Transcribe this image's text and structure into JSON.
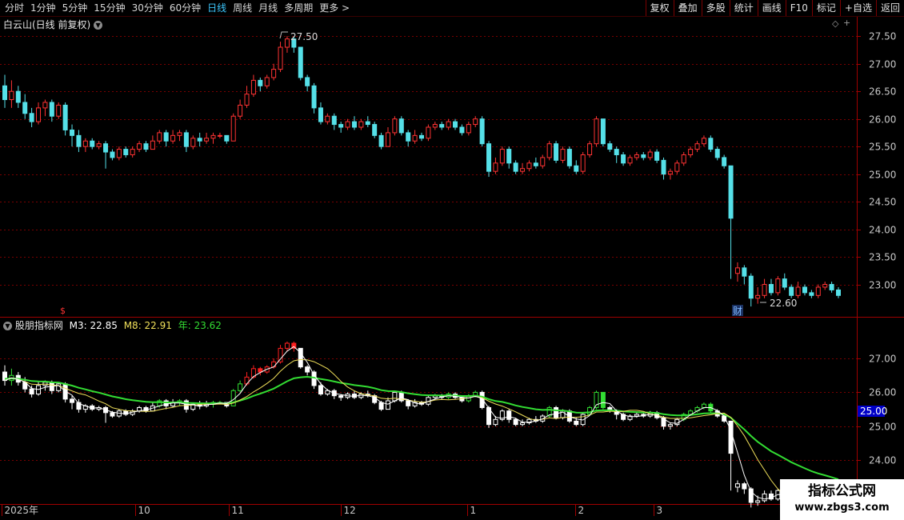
{
  "toolbar": {
    "periods": [
      "分时",
      "1分钟",
      "5分钟",
      "15分钟",
      "30分钟",
      "60分钟",
      "日线",
      "周线",
      "月线",
      "多周期",
      "更多 >"
    ],
    "active_period": "日线",
    "tools": [
      "复权",
      "叠加",
      "多股",
      "统计",
      "画线",
      "F10",
      "标记",
      "+自选",
      "返回"
    ]
  },
  "main": {
    "title": "白云山(日线 前复权)",
    "high_label": "27.50",
    "low_label": "22.60",
    "fin_marker": "财",
    "dollar_marker": "$"
  },
  "indicator": {
    "name": "股朋指标网",
    "m3": "M3: 22.85",
    "m8": "M8: 22.91",
    "year": "年: 23.62",
    "price_tag": "25.00"
  },
  "watermark": {
    "line1": "指标公式网",
    "line2": "www.zbgs3.com"
  },
  "colors": {
    "up": "#ff3333",
    "down": "#55e0e8",
    "grid": "#7a0000",
    "m8": "#f0e05a",
    "year_line": "#33dd33",
    "axis_text": "#c8c8c8"
  },
  "chart_data": [
    {
      "type": "candlestick",
      "title": "白云山(日线 前复权)",
      "y_axis": {
        "ticks": [
          27.5,
          27.0,
          26.5,
          26.0,
          25.5,
          25.0,
          24.5,
          24.0,
          23.5,
          23.0
        ],
        "range": [
          22.5,
          27.75
        ]
      },
      "x_axis": {
        "labels": [
          "2025年",
          "10",
          "11",
          "12",
          "1",
          "2",
          "3"
        ]
      },
      "candles": [
        [
          26.6,
          26.35,
          26.8,
          26.2
        ],
        [
          26.35,
          26.5,
          26.7,
          26.2
        ],
        [
          26.5,
          26.3,
          26.6,
          26.2
        ],
        [
          26.3,
          26.1,
          26.45,
          26.0
        ],
        [
          26.1,
          25.95,
          26.2,
          25.85
        ],
        [
          25.95,
          26.2,
          26.3,
          25.9
        ],
        [
          26.2,
          26.3,
          26.35,
          26.05
        ],
        [
          26.3,
          26.05,
          26.35,
          25.95
        ],
        [
          26.05,
          26.25,
          26.3,
          26.0
        ],
        [
          26.25,
          25.8,
          26.3,
          25.7
        ],
        [
          25.8,
          25.7,
          25.9,
          25.5
        ],
        [
          25.7,
          25.5,
          25.8,
          25.4
        ],
        [
          25.5,
          25.6,
          25.65,
          25.4
        ],
        [
          25.6,
          25.5,
          25.65,
          25.45
        ],
        [
          25.5,
          25.55,
          25.6,
          25.45
        ],
        [
          25.55,
          25.4,
          25.6,
          25.1
        ],
        [
          25.4,
          25.3,
          25.45,
          25.25
        ],
        [
          25.3,
          25.45,
          25.5,
          25.25
        ],
        [
          25.45,
          25.35,
          25.5,
          25.3
        ],
        [
          25.35,
          25.45,
          25.5,
          25.3
        ],
        [
          25.45,
          25.55,
          25.6,
          25.4
        ],
        [
          25.55,
          25.45,
          25.6,
          25.4
        ],
        [
          25.45,
          25.6,
          25.7,
          25.45
        ],
        [
          25.6,
          25.75,
          25.8,
          25.55
        ],
        [
          25.75,
          25.6,
          25.8,
          25.5
        ],
        [
          25.6,
          25.7,
          25.8,
          25.55
        ],
        [
          25.7,
          25.75,
          25.8,
          25.6
        ],
        [
          25.75,
          25.5,
          25.8,
          25.4
        ],
        [
          25.5,
          25.65,
          25.7,
          25.45
        ],
        [
          25.65,
          25.6,
          25.75,
          25.5
        ],
        [
          25.6,
          25.65,
          25.75,
          25.55
        ],
        [
          25.65,
          25.7,
          25.75,
          25.55
        ],
        [
          25.7,
          25.7,
          25.75,
          25.65
        ],
        [
          25.7,
          25.6,
          25.7,
          25.55
        ],
        [
          25.6,
          26.05,
          26.1,
          25.9
        ],
        [
          26.05,
          26.25,
          26.35,
          26.0
        ],
        [
          26.25,
          26.45,
          26.6,
          26.2
        ],
        [
          26.45,
          26.7,
          26.8,
          26.4
        ],
        [
          26.7,
          26.6,
          26.75,
          26.5
        ],
        [
          26.6,
          26.75,
          26.8,
          26.55
        ],
        [
          26.75,
          26.9,
          27.0,
          26.7
        ],
        [
          26.9,
          27.3,
          27.4,
          26.85
        ],
        [
          27.3,
          27.45,
          27.5,
          27.2
        ],
        [
          27.45,
          27.3,
          27.5,
          27.2
        ],
        [
          27.3,
          26.75,
          27.3,
          26.7
        ],
        [
          26.75,
          26.6,
          26.8,
          26.5
        ],
        [
          26.6,
          26.2,
          26.65,
          26.1
        ],
        [
          26.2,
          25.95,
          26.3,
          25.9
        ],
        [
          25.95,
          26.05,
          26.1,
          25.9
        ],
        [
          26.05,
          25.9,
          26.1,
          25.8
        ],
        [
          25.9,
          25.85,
          25.95,
          25.75
        ],
        [
          25.85,
          25.95,
          26.0,
          25.8
        ],
        [
          25.95,
          25.85,
          26.05,
          25.8
        ],
        [
          25.85,
          25.95,
          26.0,
          25.8
        ],
        [
          25.95,
          25.9,
          26.05,
          25.85
        ],
        [
          25.9,
          25.7,
          25.95,
          25.65
        ],
        [
          25.7,
          25.5,
          25.75,
          25.45
        ],
        [
          25.5,
          25.75,
          25.85,
          25.5
        ],
        [
          25.75,
          26.0,
          26.05,
          25.7
        ],
        [
          26.0,
          25.75,
          26.05,
          25.7
        ],
        [
          25.75,
          25.6,
          25.8,
          25.5
        ],
        [
          25.6,
          25.7,
          25.8,
          25.55
        ],
        [
          25.7,
          25.65,
          25.75,
          25.6
        ],
        [
          25.65,
          25.85,
          25.9,
          25.6
        ],
        [
          25.85,
          25.9,
          25.95,
          25.8
        ],
        [
          25.9,
          25.85,
          25.95,
          25.8
        ],
        [
          25.85,
          25.95,
          26.0,
          25.8
        ],
        [
          25.95,
          25.85,
          26.0,
          25.8
        ],
        [
          25.85,
          25.75,
          25.9,
          25.7
        ],
        [
          25.75,
          25.9,
          25.95,
          25.7
        ],
        [
          25.9,
          26.0,
          26.05,
          25.85
        ],
        [
          26.0,
          25.55,
          26.05,
          25.5
        ],
        [
          25.55,
          25.05,
          25.6,
          24.95
        ],
        [
          25.05,
          25.2,
          25.3,
          25.0
        ],
        [
          25.2,
          25.45,
          25.5,
          25.15
        ],
        [
          25.45,
          25.2,
          25.5,
          25.1
        ],
        [
          25.2,
          25.05,
          25.25,
          25.0
        ],
        [
          25.05,
          25.1,
          25.2,
          25.0
        ],
        [
          25.1,
          25.2,
          25.25,
          25.05
        ],
        [
          25.2,
          25.15,
          25.3,
          25.1
        ],
        [
          25.15,
          25.3,
          25.35,
          25.1
        ],
        [
          25.3,
          25.55,
          25.6,
          25.25
        ],
        [
          25.55,
          25.25,
          25.6,
          25.2
        ],
        [
          25.25,
          25.45,
          25.5,
          25.2
        ],
        [
          25.45,
          25.15,
          25.5,
          25.1
        ],
        [
          25.15,
          25.05,
          25.25,
          25.0
        ],
        [
          25.05,
          25.35,
          25.4,
          25.0
        ],
        [
          25.35,
          25.55,
          25.6,
          25.3
        ],
        [
          25.55,
          26.0,
          26.05,
          25.5
        ],
        [
          26.0,
          25.55,
          26.0,
          25.5
        ],
        [
          25.55,
          25.45,
          25.6,
          25.4
        ],
        [
          25.45,
          25.35,
          25.5,
          25.2
        ],
        [
          25.35,
          25.2,
          25.4,
          25.15
        ],
        [
          25.2,
          25.3,
          25.35,
          25.15
        ],
        [
          25.3,
          25.35,
          25.4,
          25.25
        ],
        [
          25.35,
          25.3,
          25.4,
          25.25
        ],
        [
          25.3,
          25.4,
          25.45,
          25.25
        ],
        [
          25.4,
          25.25,
          25.45,
          25.2
        ],
        [
          25.25,
          25.0,
          25.3,
          24.9
        ],
        [
          25.0,
          25.05,
          25.1,
          24.9
        ],
        [
          25.05,
          25.2,
          25.25,
          25.0
        ],
        [
          25.2,
          25.35,
          25.4,
          25.15
        ],
        [
          25.35,
          25.45,
          25.5,
          25.3
        ],
        [
          25.45,
          25.55,
          25.6,
          25.4
        ],
        [
          25.55,
          25.65,
          25.7,
          25.5
        ],
        [
          25.65,
          25.45,
          25.7,
          25.4
        ],
        [
          25.45,
          25.3,
          25.5,
          25.25
        ],
        [
          25.3,
          25.15,
          25.35,
          25.1
        ],
        [
          25.15,
          24.2,
          25.15,
          23.1
        ],
        [
          23.2,
          23.3,
          23.4,
          23.05
        ],
        [
          23.3,
          23.15,
          23.35,
          23.0
        ],
        [
          23.15,
          22.75,
          23.2,
          22.6
        ],
        [
          22.75,
          22.8,
          22.95,
          22.65
        ],
        [
          22.8,
          23.0,
          23.1,
          22.75
        ],
        [
          23.0,
          22.85,
          23.1,
          22.8
        ],
        [
          22.85,
          23.1,
          23.15,
          22.8
        ],
        [
          23.1,
          22.95,
          23.2,
          22.9
        ],
        [
          22.95,
          22.8,
          23.0,
          22.75
        ],
        [
          22.8,
          22.95,
          23.05,
          22.75
        ],
        [
          22.95,
          22.85,
          23.0,
          22.8
        ],
        [
          22.85,
          22.8,
          22.9,
          22.75
        ],
        [
          22.8,
          22.95,
          23.0,
          22.75
        ],
        [
          22.95,
          23.0,
          23.05,
          22.9
        ],
        [
          23.0,
          22.9,
          23.05,
          22.85
        ],
        [
          22.9,
          22.8,
          22.95,
          22.75
        ]
      ]
    },
    {
      "type": "line",
      "title": "股朋指标网",
      "y_axis": {
        "ticks": [
          27.0,
          26.0,
          25.0,
          24.0
        ],
        "range": [
          22.75,
          27.9
        ]
      },
      "series": [
        {
          "name": "M3",
          "last": 22.85
        },
        {
          "name": "M8",
          "last": 22.91
        },
        {
          "name": "年",
          "last": 23.62
        }
      ]
    }
  ]
}
